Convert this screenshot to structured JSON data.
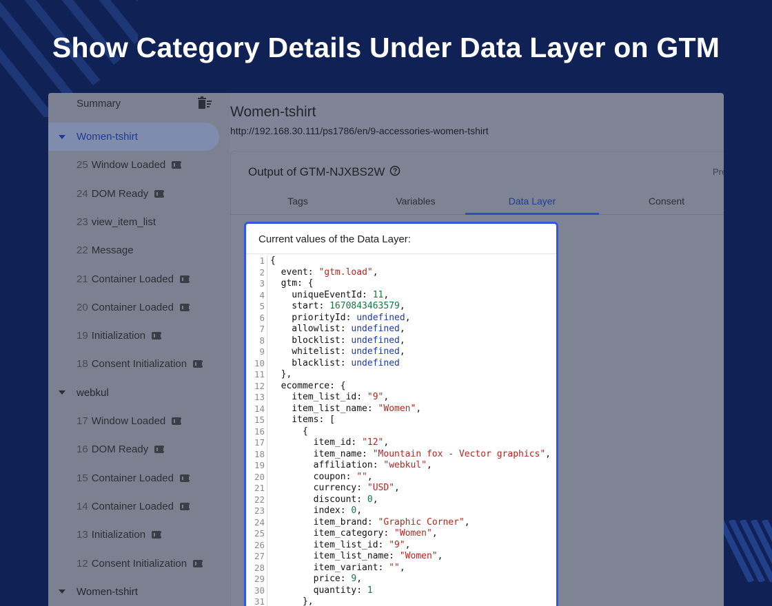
{
  "headline": "Show Category Details Under Data Layer on GTM",
  "sidebar": {
    "summary_label": "Summary",
    "rows": [
      {
        "type": "group",
        "label": "Women-tshirt",
        "active": true
      },
      {
        "type": "event",
        "num": "25",
        "label": "Window Loaded",
        "tag": true
      },
      {
        "type": "event",
        "num": "24",
        "label": "DOM Ready",
        "tag": true
      },
      {
        "type": "event",
        "num": "23",
        "label": "view_item_list",
        "tag": false
      },
      {
        "type": "event",
        "num": "22",
        "label": "Message",
        "tag": false
      },
      {
        "type": "event",
        "num": "21",
        "label": "Container Loaded",
        "tag": true
      },
      {
        "type": "event",
        "num": "20",
        "label": "Container Loaded",
        "tag": true
      },
      {
        "type": "event",
        "num": "19",
        "label": "Initialization",
        "tag": true
      },
      {
        "type": "event",
        "num": "18",
        "label": "Consent Initialization",
        "tag": true
      },
      {
        "type": "group",
        "label": "webkul",
        "active": false
      },
      {
        "type": "event",
        "num": "17",
        "label": "Window Loaded",
        "tag": true
      },
      {
        "type": "event",
        "num": "16",
        "label": "DOM Ready",
        "tag": true
      },
      {
        "type": "event",
        "num": "15",
        "label": "Container Loaded",
        "tag": true
      },
      {
        "type": "event",
        "num": "14",
        "label": "Container Loaded",
        "tag": true
      },
      {
        "type": "event",
        "num": "13",
        "label": "Initialization",
        "tag": true
      },
      {
        "type": "event",
        "num": "12",
        "label": "Consent Initialization",
        "tag": true
      },
      {
        "type": "group",
        "label": "Women-tshirt",
        "active": false
      }
    ]
  },
  "main": {
    "title": "Women-tshirt",
    "url": "http://192.168.30.111/ps1786/en/9-accessories-women-tshirt",
    "output_title": "Output of GTM-NJXBS2W",
    "preview_label": "Pre",
    "tabs": [
      {
        "label": "Tags",
        "active": false
      },
      {
        "label": "Variables",
        "active": false
      },
      {
        "label": "Data Layer",
        "active": true
      },
      {
        "label": "Consent",
        "active": false
      }
    ]
  },
  "data_layer": {
    "header": "Current values of the Data Layer:",
    "lines": [
      [
        [
          "p",
          "{"
        ]
      ],
      [
        [
          "p",
          "  event: "
        ],
        [
          "s",
          "\"gtm.load\""
        ],
        [
          "p",
          ","
        ]
      ],
      [
        [
          "p",
          "  gtm: {"
        ]
      ],
      [
        [
          "p",
          "    uniqueEventId: "
        ],
        [
          "n",
          "11"
        ],
        [
          "p",
          ","
        ]
      ],
      [
        [
          "p",
          "    start: "
        ],
        [
          "n",
          "1670843463579"
        ],
        [
          "p",
          ","
        ]
      ],
      [
        [
          "p",
          "    priorityId: "
        ],
        [
          "u",
          "undefined"
        ],
        [
          "p",
          ","
        ]
      ],
      [
        [
          "p",
          "    allowlist: "
        ],
        [
          "u",
          "undefined"
        ],
        [
          "p",
          ","
        ]
      ],
      [
        [
          "p",
          "    blocklist: "
        ],
        [
          "u",
          "undefined"
        ],
        [
          "p",
          ","
        ]
      ],
      [
        [
          "p",
          "    whitelist: "
        ],
        [
          "u",
          "undefined"
        ],
        [
          "p",
          ","
        ]
      ],
      [
        [
          "p",
          "    blacklist: "
        ],
        [
          "u",
          "undefined"
        ]
      ],
      [
        [
          "p",
          "  },"
        ]
      ],
      [
        [
          "p",
          "  ecommerce: {"
        ]
      ],
      [
        [
          "p",
          "    item_list_id: "
        ],
        [
          "s",
          "\"9\""
        ],
        [
          "p",
          ","
        ]
      ],
      [
        [
          "p",
          "    item_list_name: "
        ],
        [
          "s",
          "\"Women\""
        ],
        [
          "p",
          ","
        ]
      ],
      [
        [
          "p",
          "    items: ["
        ]
      ],
      [
        [
          "p",
          "      {"
        ]
      ],
      [
        [
          "p",
          "        item_id: "
        ],
        [
          "s",
          "\"12\""
        ],
        [
          "p",
          ","
        ]
      ],
      [
        [
          "p",
          "        item_name: "
        ],
        [
          "s",
          "\"Mountain fox - Vector graphics\""
        ],
        [
          "p",
          ","
        ]
      ],
      [
        [
          "p",
          "        affiliation: "
        ],
        [
          "s",
          "\"webkul\""
        ],
        [
          "p",
          ","
        ]
      ],
      [
        [
          "p",
          "        coupon: "
        ],
        [
          "s",
          "\"\""
        ],
        [
          "p",
          ","
        ]
      ],
      [
        [
          "p",
          "        currency: "
        ],
        [
          "s",
          "\"USD\""
        ],
        [
          "p",
          ","
        ]
      ],
      [
        [
          "p",
          "        discount: "
        ],
        [
          "n",
          "0"
        ],
        [
          "p",
          ","
        ]
      ],
      [
        [
          "p",
          "        index: "
        ],
        [
          "n",
          "0"
        ],
        [
          "p",
          ","
        ]
      ],
      [
        [
          "p",
          "        item_brand: "
        ],
        [
          "s",
          "\"Graphic Corner\""
        ],
        [
          "p",
          ","
        ]
      ],
      [
        [
          "p",
          "        item_category: "
        ],
        [
          "s",
          "\"Women\""
        ],
        [
          "p",
          ","
        ]
      ],
      [
        [
          "p",
          "        item_list_id: "
        ],
        [
          "s",
          "\"9\""
        ],
        [
          "p",
          ","
        ]
      ],
      [
        [
          "p",
          "        item_list_name: "
        ],
        [
          "s",
          "\"Women\""
        ],
        [
          "p",
          ","
        ]
      ],
      [
        [
          "p",
          "        item_variant: "
        ],
        [
          "s",
          "\"\""
        ],
        [
          "p",
          ","
        ]
      ],
      [
        [
          "p",
          "        price: "
        ],
        [
          "n",
          "9"
        ],
        [
          "p",
          ","
        ]
      ],
      [
        [
          "p",
          "        quantity: "
        ],
        [
          "n",
          "1"
        ]
      ],
      [
        [
          "p",
          "      },"
        ]
      ]
    ]
  }
}
